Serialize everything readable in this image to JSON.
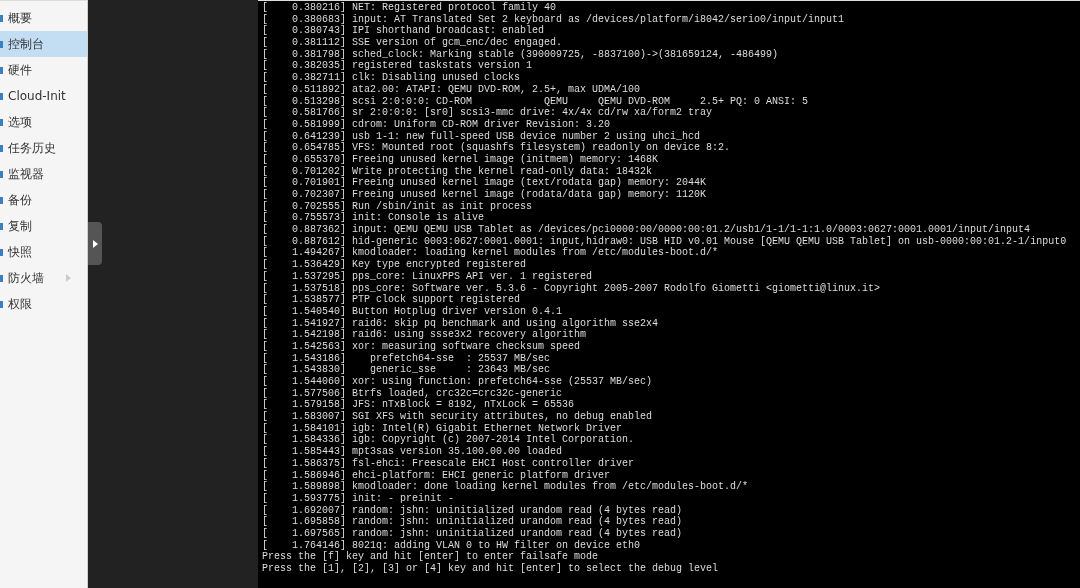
{
  "sidebar": {
    "items": [
      {
        "label": "概要",
        "selected": false,
        "submenu": false
      },
      {
        "label": "控制台",
        "selected": true,
        "submenu": false
      },
      {
        "label": "硬件",
        "selected": false,
        "submenu": false
      },
      {
        "label": "Cloud-Init",
        "selected": false,
        "submenu": false
      },
      {
        "label": "选项",
        "selected": false,
        "submenu": false
      },
      {
        "label": "任务历史",
        "selected": false,
        "submenu": false
      },
      {
        "label": "监视器",
        "selected": false,
        "submenu": false
      },
      {
        "label": "备份",
        "selected": false,
        "submenu": false
      },
      {
        "label": "复制",
        "selected": false,
        "submenu": false
      },
      {
        "label": "快照",
        "selected": false,
        "submenu": false
      },
      {
        "label": "防火墙",
        "selected": false,
        "submenu": true
      },
      {
        "label": "权限",
        "selected": false,
        "submenu": false
      }
    ]
  },
  "console": {
    "lines": [
      "[    0.380216] NET: Registered protocol family 40",
      "[    0.380683] input: AT Translated Set 2 keyboard as /devices/platform/i8042/serio0/input/input1",
      "[    0.380743] IPI shorthand broadcast: enabled",
      "[    0.381112] SSE version of gcm_enc/dec engaged.",
      "[    0.381798] sched_clock: Marking stable (390009725, -8837100)->(381659124, -486499)",
      "[    0.382035] registered taskstats version 1",
      "[    0.382711] clk: Disabling unused clocks",
      "[    0.511892] ata2.00: ATAPI: QEMU DVD-ROM, 2.5+, max UDMA/100",
      "[    0.513298] scsi 2:0:0:0: CD-ROM            QEMU     QEMU DVD-ROM     2.5+ PQ: 0 ANSI: 5",
      "[    0.581766] sr 2:0:0:0: [sr0] scsi3-mmc drive: 4x/4x cd/rw xa/form2 tray",
      "[    0.581999] cdrom: Uniform CD-ROM driver Revision: 3.20",
      "[    0.641239] usb 1-1: new full-speed USB device number 2 using uhci_hcd",
      "[    0.654785] VFS: Mounted root (squashfs filesystem) readonly on device 8:2.",
      "[    0.655370] Freeing unused kernel image (initmem) memory: 1468K",
      "[    0.701202] Write protecting the kernel read-only data: 18432k",
      "[    0.701901] Freeing unused kernel image (text/rodata gap) memory: 2044K",
      "[    0.702307] Freeing unused kernel image (rodata/data gap) memory: 1120K",
      "[    0.702555] Run /sbin/init as init process",
      "[    0.755573] init: Console is alive",
      "[    0.887362] input: QEMU QEMU USB Tablet as /devices/pci0000:00/0000:00:01.2/usb1/1-1/1-1:1.0/0003:0627:0001.0001/input/input4",
      "[    0.887612] hid-generic 0003:0627:0001.0001: input,hidraw0: USB HID v0.01 Mouse [QEMU QEMU USB Tablet] on usb-0000:00:01.2-1/input0",
      "[    1.494267] kmodloader: loading kernel modules from /etc/modules-boot.d/*",
      "[    1.536429] Key type encrypted registered",
      "[    1.537295] pps_core: LinuxPPS API ver. 1 registered",
      "[    1.537518] pps_core: Software ver. 5.3.6 - Copyright 2005-2007 Rodolfo Giometti <giometti@linux.it>",
      "[    1.538577] PTP clock support registered",
      "[    1.540540] Button Hotplug driver version 0.4.1",
      "[    1.541927] raid6: skip pq benchmark and using algorithm sse2x4",
      "[    1.542198] raid6: using ssse3x2 recovery algorithm",
      "[    1.542563] xor: measuring software checksum speed",
      "[    1.543186]    prefetch64-sse  : 25537 MB/sec",
      "[    1.543830]    generic_sse     : 23643 MB/sec",
      "[    1.544060] xor: using function: prefetch64-sse (25537 MB/sec)",
      "[    1.577506] Btrfs loaded, crc32c=crc32c-generic",
      "[    1.579158] JFS: nTxBlock = 8192, nTxLock = 65536",
      "[    1.583007] SGI XFS with security attributes, no debug enabled",
      "[    1.584101] igb: Intel(R) Gigabit Ethernet Network Driver",
      "[    1.584336] igb: Copyright (c) 2007-2014 Intel Corporation.",
      "[    1.585443] mpt3sas version 35.100.00.00 loaded",
      "[    1.586375] fsl-ehci: Freescale EHCI Host controller driver",
      "[    1.586946] ehci-platform: EHCI generic platform driver",
      "[    1.589898] kmodloader: done loading kernel modules from /etc/modules-boot.d/*",
      "[    1.593775] init: - preinit -",
      "[    1.692007] random: jshn: uninitialized urandom read (4 bytes read)",
      "[    1.695858] random: jshn: uninitialized urandom read (4 bytes read)",
      "[    1.697565] random: jshn: uninitialized urandom read (4 bytes read)",
      "[    1.764146] 8021q: adding VLAN 0 to HW filter on device eth0",
      "Press the [f] key and hit [enter] to enter failsafe mode",
      "Press the [1], [2], [3] or [4] key and hit [enter] to select the debug level"
    ]
  }
}
